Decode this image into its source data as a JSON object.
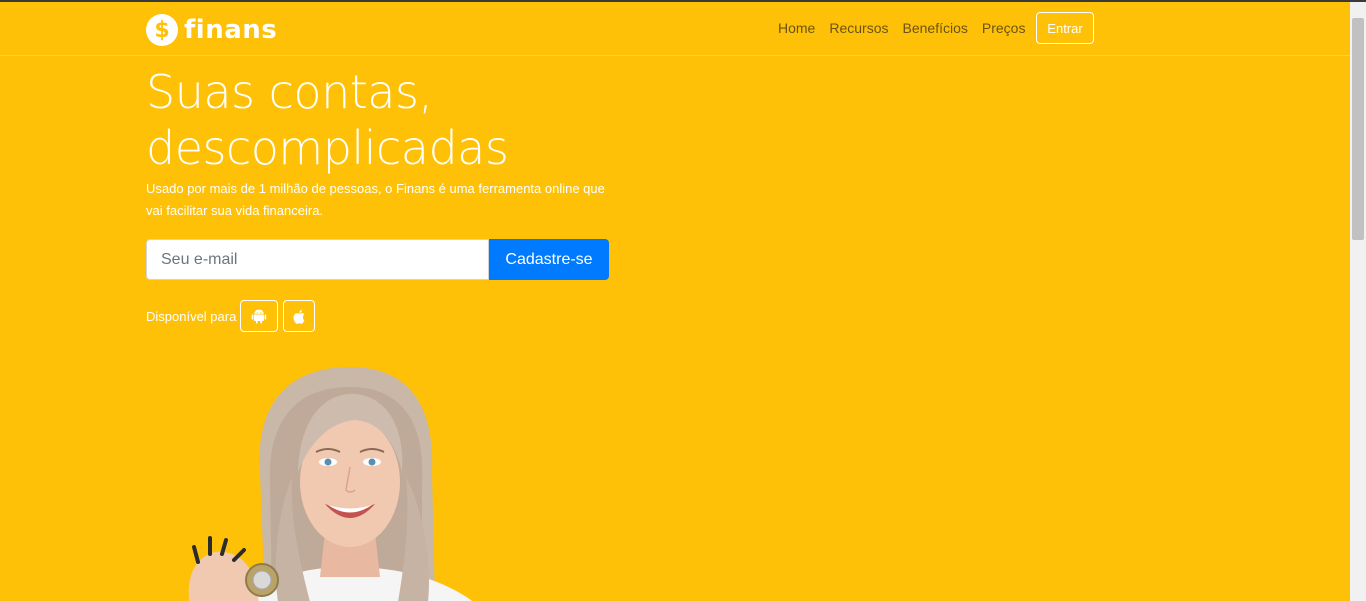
{
  "brand": {
    "name": "finans",
    "icon": "dollar-icon",
    "icon_glyph": "$"
  },
  "nav": {
    "links": [
      "Home",
      "Recursos",
      "Benefícios",
      "Preços"
    ],
    "login_label": "Entrar"
  },
  "hero": {
    "title_line1": "Suas contas,",
    "title_line2": "descomplicadas",
    "subtitle": "Usado por mais de 1 milhão de pessoas, o Finans é uma ferramenta online que vai facilitar sua vida financeira.",
    "email_placeholder": "Seu e-mail",
    "signup_label": "Cadastre-se",
    "available_label": "Disponível para",
    "stores": [
      "android-icon",
      "apple-icon"
    ]
  },
  "colors": {
    "background": "#ffc107",
    "primary_button": "#007bff",
    "text": "#ffffff",
    "nav_link": "#6b5410"
  }
}
